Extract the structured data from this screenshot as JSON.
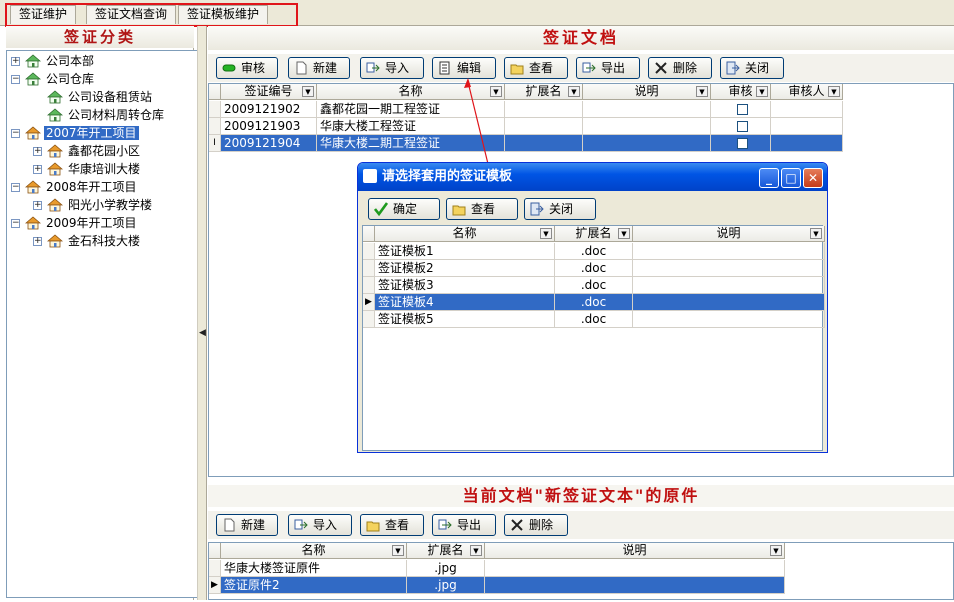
{
  "tabs": [
    "签证维护",
    "签证文档查询",
    "签证模板维护"
  ],
  "left": {
    "title": "签证分类",
    "tree": [
      {
        "label": "公司本部",
        "level": 0,
        "exp": "+"
      },
      {
        "label": "公司仓库",
        "level": 0,
        "exp": "-"
      },
      {
        "label": "公司设备租赁站",
        "level": 1,
        "exp": ""
      },
      {
        "label": "公司材料周转仓库",
        "level": 1,
        "exp": ""
      },
      {
        "label": "2007年开工项目",
        "level": 0,
        "exp": "-",
        "selected": true
      },
      {
        "label": "鑫都花园小区",
        "level": 1,
        "exp": "+"
      },
      {
        "label": "华康培训大楼",
        "level": 1,
        "exp": "+"
      },
      {
        "label": "2008年开工项目",
        "level": 0,
        "exp": "-"
      },
      {
        "label": "阳光小学教学楼",
        "level": 1,
        "exp": "+"
      },
      {
        "label": "2009年开工项目",
        "level": 0,
        "exp": "-"
      },
      {
        "label": "金石科技大楼",
        "level": 1,
        "exp": "+"
      }
    ]
  },
  "main": {
    "title": "签证文档",
    "toolbar": [
      "审核",
      "新建",
      "导入",
      "编辑",
      "查看",
      "导出",
      "删除",
      "关闭"
    ],
    "columns": [
      "签证编号",
      "名称",
      "扩展名",
      "说明",
      "审核",
      "审核人"
    ],
    "rows": [
      {
        "code": "2009121902",
        "name": "鑫都花园一期工程签证",
        "ext": "",
        "note": "",
        "reviewer": ""
      },
      {
        "code": "2009121903",
        "name": "华康大楼工程签证",
        "ext": "",
        "note": "",
        "reviewer": ""
      },
      {
        "code": "2009121904",
        "name": "华康大楼二期工程签证",
        "ext": "",
        "note": "",
        "reviewer": "",
        "selected": true
      }
    ]
  },
  "dialog": {
    "title": "请选择套用的签证模板",
    "buttons": [
      "确定",
      "查看",
      "关闭"
    ],
    "columns": [
      "名称",
      "扩展名",
      "说明"
    ],
    "rows": [
      {
        "name": "签证模板1",
        "ext": ".doc"
      },
      {
        "name": "签证模板2",
        "ext": ".doc"
      },
      {
        "name": "签证模板3",
        "ext": ".doc"
      },
      {
        "name": "签证模板4",
        "ext": ".doc",
        "selected": true
      },
      {
        "name": "签证模板5",
        "ext": ".doc"
      }
    ]
  },
  "bottom": {
    "title": "当前文档\"新签证文本\"的原件",
    "toolbar": [
      "新建",
      "导入",
      "查看",
      "导出",
      "删除"
    ],
    "columns": [
      "名称",
      "扩展名",
      "说明"
    ],
    "rows": [
      {
        "name": "华康大楼签证原件",
        "ext": ".jpg"
      },
      {
        "name": "签证原件2",
        "ext": ".jpg",
        "selected": true
      }
    ]
  },
  "colors": {
    "accent": "#316ac5",
    "title_red": "#c01010",
    "highlight_border": "#e0151a"
  }
}
